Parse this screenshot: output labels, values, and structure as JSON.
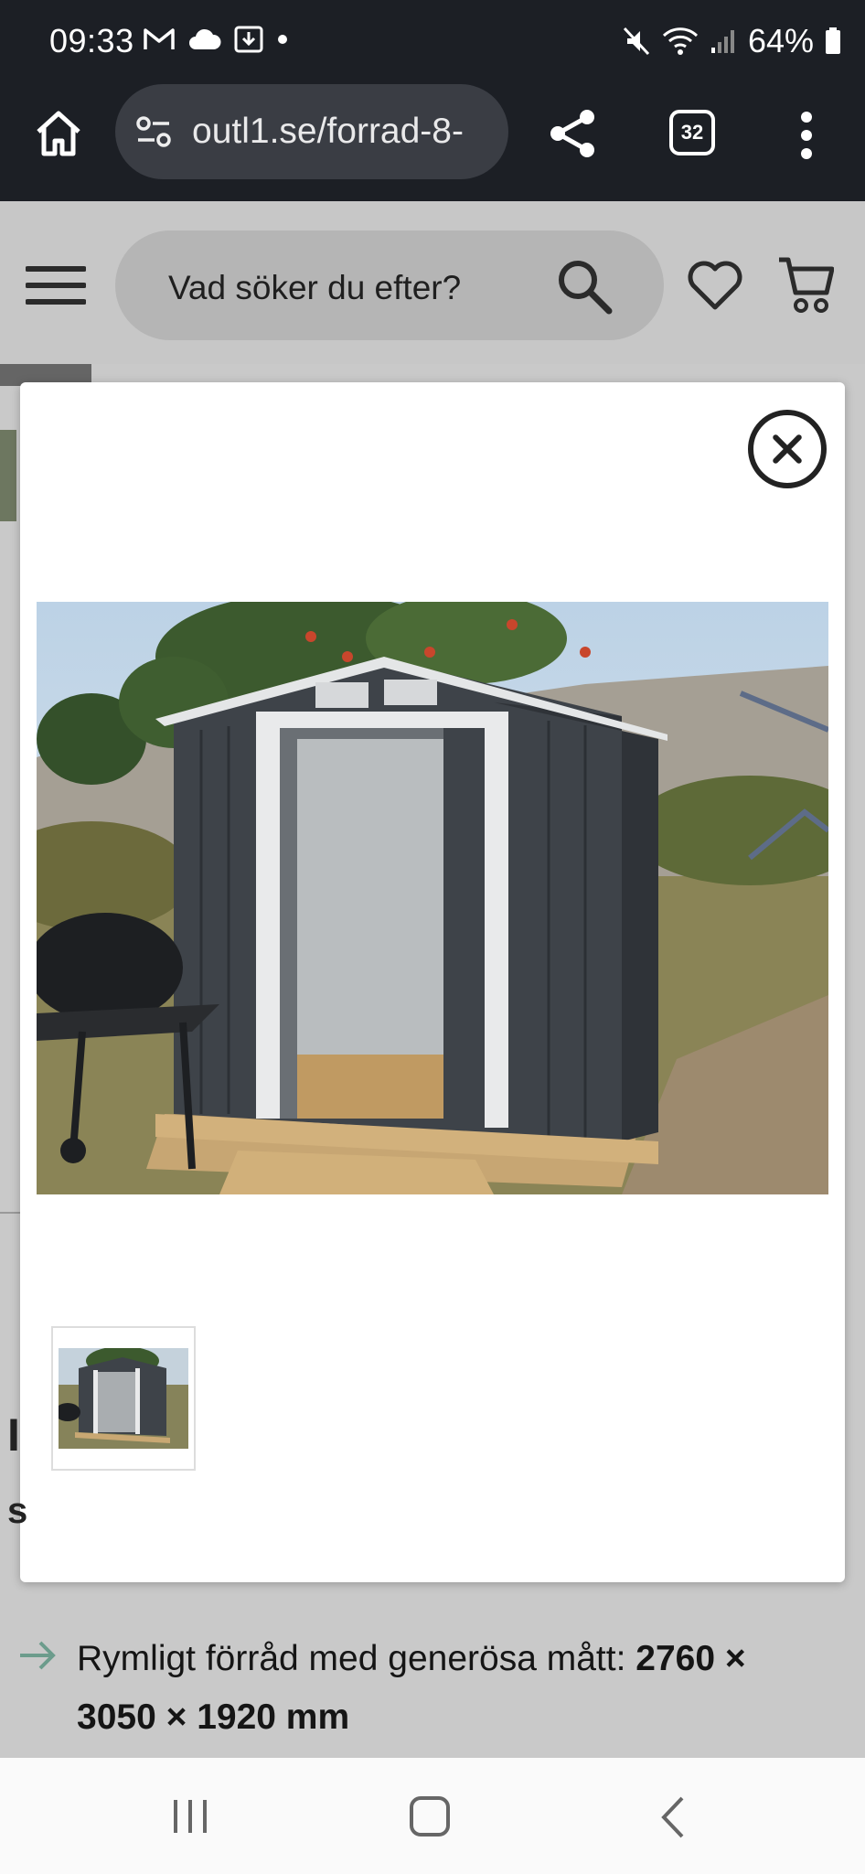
{
  "status": {
    "time": "09:33",
    "battery": "64%",
    "left_icons": [
      "gmail-icon",
      "cloud-icon",
      "download-icon",
      "dot-icon"
    ],
    "right_icons": [
      "mute-icon",
      "wifi-icon",
      "signal-icon",
      "battery-icon"
    ]
  },
  "browser": {
    "url": "outl1.se/forrad-8-",
    "tab_count": "32"
  },
  "site": {
    "search_placeholder": "Vad söker du efter?"
  },
  "modal": {
    "image_alt": "Mörkgrått metallförråd med skjutdörrar på trädäck",
    "thumbnail_count": 1
  },
  "page": {
    "bullet_prefix": "Rymligt förråd med generösa mått: ",
    "bullet_strong": "2760 × 3050 × 1920 mm"
  },
  "colors": {
    "status_bg": "#1c1f25",
    "url_bg": "#3a3d44",
    "overlay": "#c9c9c9",
    "shed": "#3e4349"
  }
}
